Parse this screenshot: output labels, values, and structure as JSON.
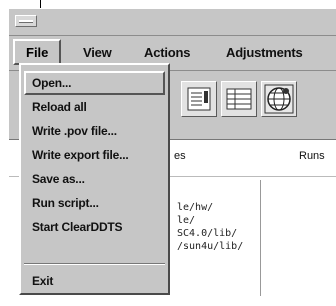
{
  "menubar": {
    "items": [
      {
        "label": "File"
      },
      {
        "label": "View"
      },
      {
        "label": "Actions"
      },
      {
        "label": "Adjustments"
      }
    ]
  },
  "panel": {
    "columns": [
      "es",
      "Runs"
    ],
    "paths": [
      "le/hw/",
      "le/",
      "SC4.0/lib/",
      "/sun4u/lib/"
    ]
  },
  "file_menu": {
    "items": [
      {
        "label": "Open..."
      },
      {
        "label": "Reload all"
      },
      {
        "label": "Write .pov file..."
      },
      {
        "label": "Write export file..."
      },
      {
        "label": "Save as..."
      },
      {
        "label": "Run script..."
      },
      {
        "label": "Start ClearDDTS"
      },
      {
        "label": "Exit"
      }
    ]
  }
}
